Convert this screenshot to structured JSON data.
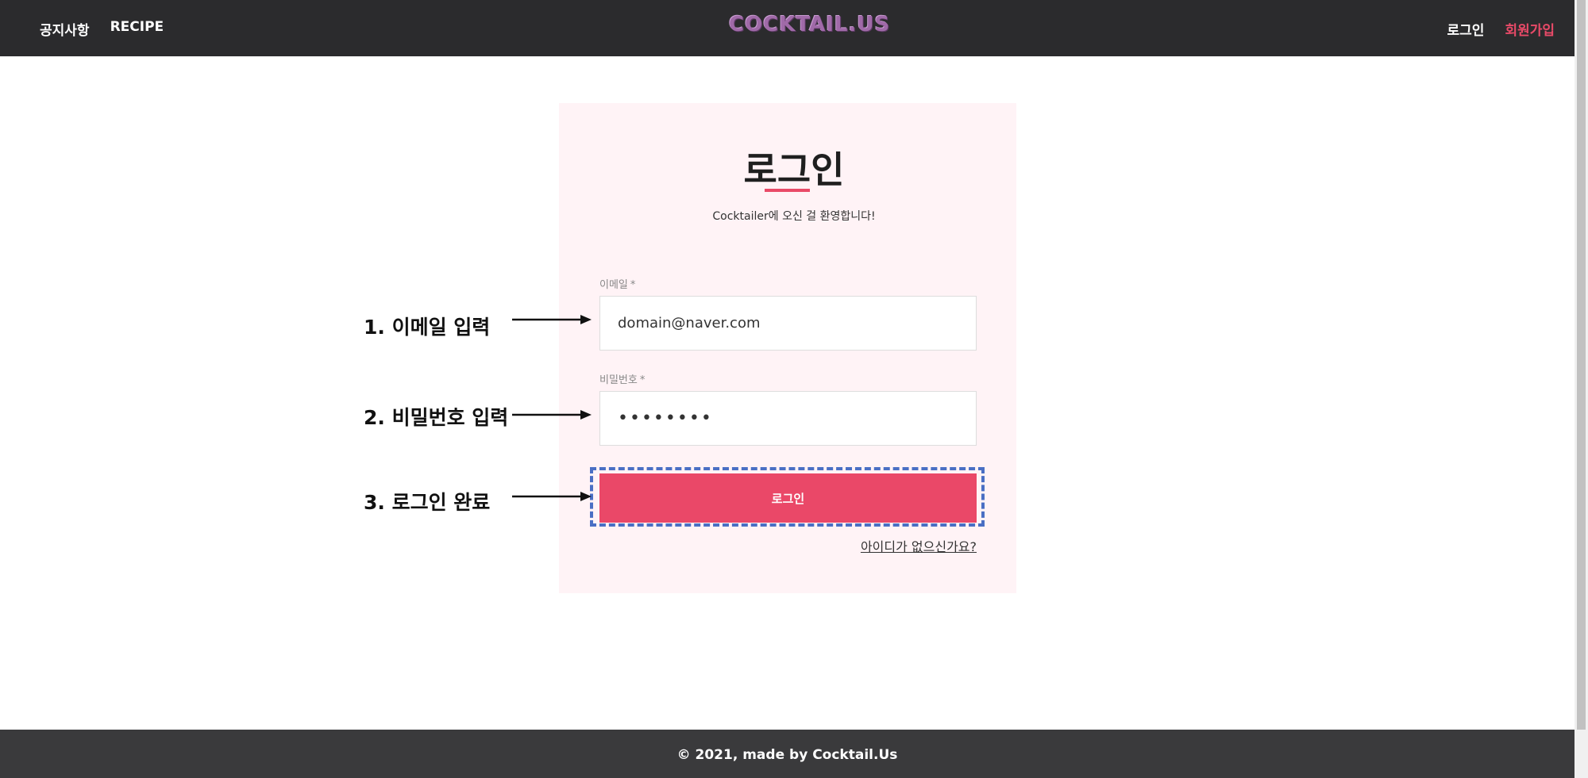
{
  "header": {
    "nav_left": [
      "공지사항",
      "RECIPE"
    ],
    "logo": "COCKTAIL.US",
    "nav_right": {
      "login": "로그인",
      "signup": "회원가입"
    }
  },
  "login_form": {
    "title": "로그인",
    "subtitle": "Cocktailer에 오신 걸 환영합니다!",
    "email_label": "이메일",
    "email_required": "*",
    "email_value": "domain@naver.com",
    "password_label": "비밀번호",
    "password_required": "*",
    "password_value": "••••••••",
    "submit_label": "로그인",
    "signup_link": "아이디가 없으신가요?"
  },
  "annotations": {
    "step1": "1. 이메일 입력",
    "step2": "2. 비밀번호 입력",
    "step3": "3. 로그인 완료"
  },
  "footer": {
    "text": "© 2021, made by Cocktail.Us"
  },
  "colors": {
    "accent": "#ea4868",
    "header_bg": "#2b2b2d",
    "card_bg": "#fff3f6",
    "highlight": "#4a6fc4"
  }
}
